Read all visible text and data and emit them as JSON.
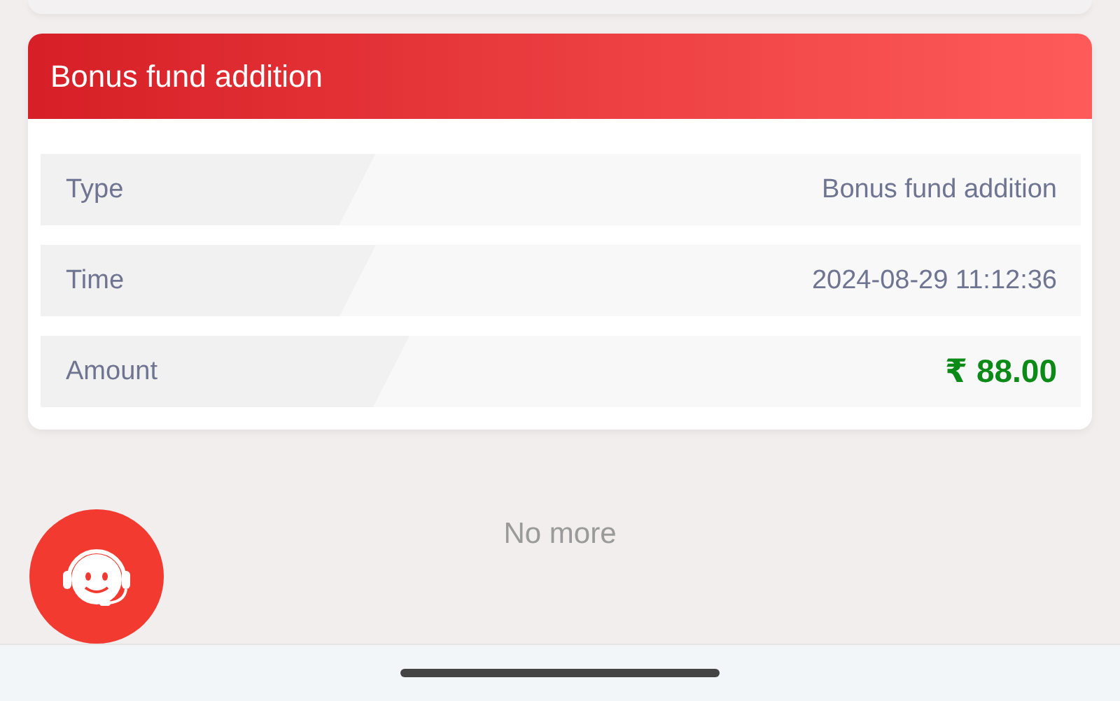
{
  "record": {
    "title": "Bonus fund addition",
    "rows": [
      {
        "kind": "text",
        "label": "Type",
        "value": "Bonus fund addition"
      },
      {
        "kind": "text",
        "label": "Time",
        "value": "2024-08-29 11:12:36"
      },
      {
        "kind": "amount",
        "label": "Amount",
        "value": "₹ 88.00"
      }
    ]
  },
  "footer_text": "No more"
}
